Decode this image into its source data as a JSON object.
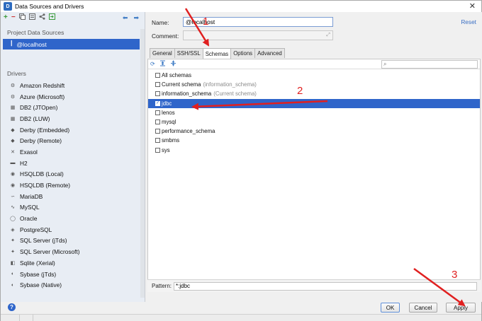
{
  "window": {
    "title": "Data Sources and Drivers",
    "close_glyph": "✕"
  },
  "left": {
    "project_section_title": "Project Data Sources",
    "selected_source": "@localhost",
    "drivers_section_title": "Drivers",
    "drivers": [
      {
        "label": "Amazon Redshift",
        "icon": "cluster-icon"
      },
      {
        "label": "Azure (Microsoft)",
        "icon": "cluster-icon"
      },
      {
        "label": "DB2 (JTOpen)",
        "icon": "db2-icon"
      },
      {
        "label": "DB2 (LUW)",
        "icon": "db2-icon"
      },
      {
        "label": "Derby (Embedded)",
        "icon": "derby-icon"
      },
      {
        "label": "Derby (Remote)",
        "icon": "derby-icon"
      },
      {
        "label": "Exasol",
        "icon": "exasol-icon"
      },
      {
        "label": "H2",
        "icon": "h2-icon"
      },
      {
        "label": "HSQLDB (Local)",
        "icon": "hsqldb-icon"
      },
      {
        "label": "HSQLDB (Remote)",
        "icon": "hsqldb-icon"
      },
      {
        "label": "MariaDB",
        "icon": "mariadb-icon"
      },
      {
        "label": "MySQL",
        "icon": "mysql-icon"
      },
      {
        "label": "Oracle",
        "icon": "oracle-icon"
      },
      {
        "label": "PostgreSQL",
        "icon": "postgresql-icon"
      },
      {
        "label": "SQL Server (jTds)",
        "icon": "sqlserver-icon"
      },
      {
        "label": "SQL Server (Microsoft)",
        "icon": "sqlserver-icon"
      },
      {
        "label": "Sqlite (Xerial)",
        "icon": "sqlite-icon"
      },
      {
        "label": "Sybase (jTds)",
        "icon": "sybase-icon"
      },
      {
        "label": "Sybase (Native)",
        "icon": "sybase-icon"
      }
    ]
  },
  "form": {
    "name_label": "Name:",
    "name_value": "@localhost",
    "comment_label": "Comment:",
    "reset_label": "Reset"
  },
  "tabs": [
    "General",
    "SSH/SSL",
    "Schemas",
    "Options",
    "Advanced"
  ],
  "active_tab": "Schemas",
  "schemas": [
    {
      "label": "All schemas",
      "hint": "",
      "checked": false,
      "selected": false
    },
    {
      "label": "Current schema",
      "hint": "(information_schema)",
      "checked": false,
      "selected": false
    },
    {
      "label": "information_schema",
      "hint": "(Current schema)",
      "checked": false,
      "selected": false
    },
    {
      "label": "jdbc",
      "hint": "",
      "checked": true,
      "selected": true
    },
    {
      "label": "lenos",
      "hint": "",
      "checked": false,
      "selected": false
    },
    {
      "label": "mysql",
      "hint": "",
      "checked": false,
      "selected": false
    },
    {
      "label": "performance_schema",
      "hint": "",
      "checked": false,
      "selected": false
    },
    {
      "label": "smbms",
      "hint": "",
      "checked": false,
      "selected": false
    },
    {
      "label": "sys",
      "hint": "",
      "checked": false,
      "selected": false
    }
  ],
  "pattern": {
    "label": "Pattern:",
    "value": "*:jdbc"
  },
  "buttons": {
    "ok": "OK",
    "cancel": "Cancel",
    "apply": "Apply",
    "help": "?"
  },
  "annotations": {
    "numbers": [
      "1",
      "2",
      "3"
    ],
    "color": "#e02020"
  },
  "colors": {
    "selection": "#2f65ca",
    "link": "#3a6fc4"
  }
}
